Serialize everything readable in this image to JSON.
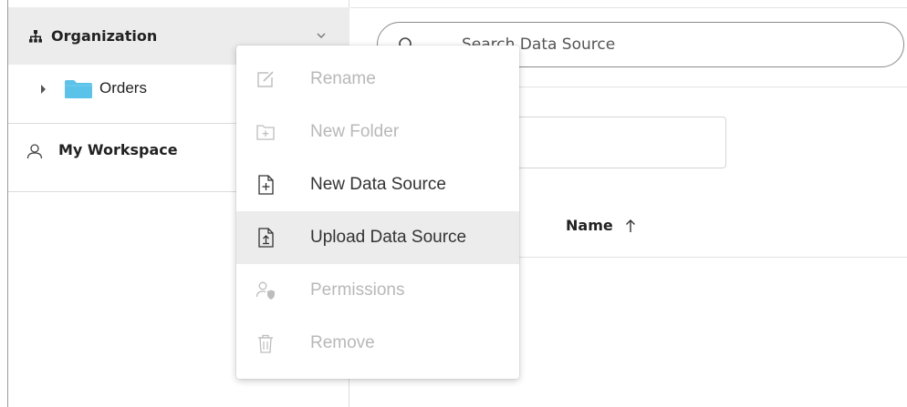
{
  "sidebar": {
    "organization": {
      "label": "Organization",
      "icon": "org-hierarchy-icon"
    },
    "tree": [
      {
        "label": "Orders",
        "icon": "folder-icon",
        "folder_color": "#5bc2ea"
      }
    ],
    "workspace": {
      "label": "My Workspace",
      "icon": "user-icon"
    }
  },
  "main": {
    "search": {
      "placeholder": "Search Data Source",
      "value": ""
    },
    "columns": [
      {
        "label": "Name",
        "sort": "ascending"
      }
    ]
  },
  "context_menu": {
    "items": [
      {
        "label": "Rename",
        "icon": "edit-icon",
        "enabled": false
      },
      {
        "label": "New Folder",
        "icon": "new-folder-icon",
        "enabled": false
      },
      {
        "label": "New Data Source",
        "icon": "new-file-icon",
        "enabled": true
      },
      {
        "label": "Upload Data Source",
        "icon": "upload-file-icon",
        "enabled": true,
        "highlighted": true
      },
      {
        "label": "Permissions",
        "icon": "permissions-icon",
        "enabled": false
      },
      {
        "label": "Remove",
        "icon": "trash-icon",
        "enabled": false
      }
    ]
  },
  "colors": {
    "header_bg": "#ececec",
    "highlight_bg": "#ececec",
    "disabled_text": "#b8b8b8",
    "enabled_text": "#333333",
    "folder": "#5bc2ea"
  }
}
